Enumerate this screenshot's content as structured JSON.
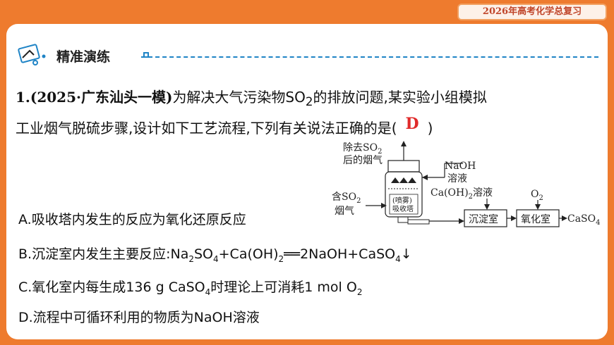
{
  "header": {
    "badge": "2026年高考化学总复习"
  },
  "section": {
    "title": "精准演练"
  },
  "question": {
    "number_source": "1.(2025·广东汕头一模)",
    "line1_rest": "为解决大气污染物SO",
    "line1_sub": "2",
    "line1_end": "的排放问题,某实验小组模拟",
    "line2_start": "工业烟气脱硫步骤,设计如下工艺流程,下列有关说法正确的是(",
    "answer": "D",
    "line2_end": ")"
  },
  "options": {
    "A": "A.吸收塔内发生的反应为氧化还原反应",
    "B": {
      "prefix": "B.沉淀室内发生主要反应:Na",
      "s1": "2",
      "m1": "SO",
      "s2": "4",
      "m2": "+Ca(OH)",
      "s3": "2",
      "m3": "══2NaOH+CaSO",
      "s4": "4",
      "end": "↓"
    },
    "C": {
      "prefix": "C.氧化室内每生成136 g CaSO",
      "s1": "4",
      "m1": "时理论上可消耗1 mol O",
      "s2": "2"
    },
    "D": "D.流程中可循环利用的物质为NaOH溶液"
  },
  "diagram": {
    "top_label_1": "除去SO",
    "top_label_1_sub": "2",
    "top_label_2": "后的烟气",
    "naoh": "NaOH",
    "solution": "溶液",
    "caoh": "Ca(OH)",
    "caoh_sub": "2",
    "caoh_end": "溶液",
    "so2_in_1": "含SO",
    "so2_in_sub": "2",
    "so2_in_2": "烟气",
    "spray": "(喷雾)",
    "tower": "吸收塔",
    "settling": "沉淀室",
    "oxidation": "氧化室",
    "o2": "O",
    "o2_sub": "2",
    "product": "CaSO",
    "product_sub": "4"
  },
  "colors": {
    "accent_orange": "#ee7b2e",
    "answer_red": "#e02a2a",
    "section_blue": "#1f84c6"
  }
}
